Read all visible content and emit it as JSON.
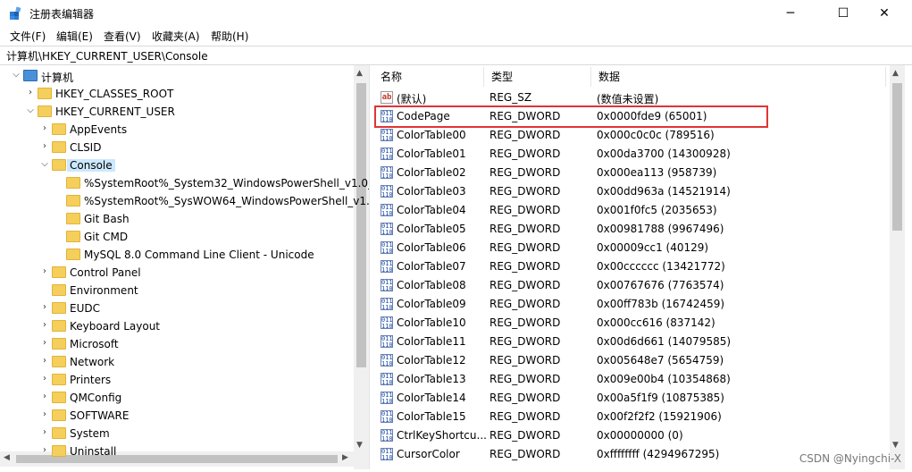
{
  "window": {
    "title": "注册表编辑器",
    "min_icon": "─",
    "max_icon": "☐",
    "close_icon": "✕"
  },
  "menu": [
    "文件(F)",
    "编辑(E)",
    "查看(V)",
    "收藏夹(A)",
    "帮助(H)"
  ],
  "address": "计算机\\HKEY_CURRENT_USER\\Console",
  "tree": [
    {
      "label": "计算机",
      "level": 0,
      "arrow": "⌵",
      "computer": true
    },
    {
      "label": "HKEY_CLASSES_ROOT",
      "level": 1,
      "arrow": "›"
    },
    {
      "label": "HKEY_CURRENT_USER",
      "level": 1,
      "arrow": "⌵"
    },
    {
      "label": "AppEvents",
      "level": 2,
      "arrow": "›"
    },
    {
      "label": "CLSID",
      "level": 2,
      "arrow": "›"
    },
    {
      "label": "Console",
      "level": 2,
      "arrow": "⌵",
      "selected": true
    },
    {
      "label": "%SystemRoot%_System32_WindowsPowerShell_v1.0_",
      "level": 3,
      "arrow": ""
    },
    {
      "label": "%SystemRoot%_SysWOW64_WindowsPowerShell_v1.",
      "level": 3,
      "arrow": ""
    },
    {
      "label": "Git Bash",
      "level": 3,
      "arrow": ""
    },
    {
      "label": "Git CMD",
      "level": 3,
      "arrow": ""
    },
    {
      "label": "MySQL 8.0 Command Line Client - Unicode",
      "level": 3,
      "arrow": ""
    },
    {
      "label": "Control Panel",
      "level": 2,
      "arrow": "›"
    },
    {
      "label": "Environment",
      "level": 2,
      "arrow": ""
    },
    {
      "label": "EUDC",
      "level": 2,
      "arrow": "›"
    },
    {
      "label": "Keyboard Layout",
      "level": 2,
      "arrow": "›"
    },
    {
      "label": "Microsoft",
      "level": 2,
      "arrow": "›"
    },
    {
      "label": "Network",
      "level": 2,
      "arrow": "›"
    },
    {
      "label": "Printers",
      "level": 2,
      "arrow": "›"
    },
    {
      "label": "QMConfig",
      "level": 2,
      "arrow": "›"
    },
    {
      "label": "SOFTWARE",
      "level": 2,
      "arrow": "›"
    },
    {
      "label": "System",
      "level": 2,
      "arrow": "›"
    },
    {
      "label": "Uninstall",
      "level": 2,
      "arrow": "›"
    }
  ],
  "columns": [
    "名称",
    "类型",
    "数据"
  ],
  "values": [
    {
      "name": "(默认)",
      "type": "REG_SZ",
      "data": "(数值未设置)",
      "icon": "sz"
    },
    {
      "name": "CodePage",
      "type": "REG_DWORD",
      "data": "0x0000fde9 (65001)",
      "icon": "dword"
    },
    {
      "name": "ColorTable00",
      "type": "REG_DWORD",
      "data": "0x000c0c0c (789516)",
      "icon": "dword"
    },
    {
      "name": "ColorTable01",
      "type": "REG_DWORD",
      "data": "0x00da3700 (14300928)",
      "icon": "dword"
    },
    {
      "name": "ColorTable02",
      "type": "REG_DWORD",
      "data": "0x000ea113 (958739)",
      "icon": "dword"
    },
    {
      "name": "ColorTable03",
      "type": "REG_DWORD",
      "data": "0x00dd963a (14521914)",
      "icon": "dword"
    },
    {
      "name": "ColorTable04",
      "type": "REG_DWORD",
      "data": "0x001f0fc5 (2035653)",
      "icon": "dword"
    },
    {
      "name": "ColorTable05",
      "type": "REG_DWORD",
      "data": "0x00981788 (9967496)",
      "icon": "dword"
    },
    {
      "name": "ColorTable06",
      "type": "REG_DWORD",
      "data": "0x00009cc1 (40129)",
      "icon": "dword"
    },
    {
      "name": "ColorTable07",
      "type": "REG_DWORD",
      "data": "0x00cccccc (13421772)",
      "icon": "dword"
    },
    {
      "name": "ColorTable08",
      "type": "REG_DWORD",
      "data": "0x00767676 (7763574)",
      "icon": "dword"
    },
    {
      "name": "ColorTable09",
      "type": "REG_DWORD",
      "data": "0x00ff783b (16742459)",
      "icon": "dword"
    },
    {
      "name": "ColorTable10",
      "type": "REG_DWORD",
      "data": "0x000cc616 (837142)",
      "icon": "dword"
    },
    {
      "name": "ColorTable11",
      "type": "REG_DWORD",
      "data": "0x00d6d661 (14079585)",
      "icon": "dword"
    },
    {
      "name": "ColorTable12",
      "type": "REG_DWORD",
      "data": "0x005648e7 (5654759)",
      "icon": "dword"
    },
    {
      "name": "ColorTable13",
      "type": "REG_DWORD",
      "data": "0x009e00b4 (10354868)",
      "icon": "dword"
    },
    {
      "name": "ColorTable14",
      "type": "REG_DWORD",
      "data": "0x00a5f1f9 (10875385)",
      "icon": "dword"
    },
    {
      "name": "ColorTable15",
      "type": "REG_DWORD",
      "data": "0x00f2f2f2 (15921906)",
      "icon": "dword"
    },
    {
      "name": "CtrlKeyShortcu...",
      "type": "REG_DWORD",
      "data": "0x00000000 (0)",
      "icon": "dword"
    },
    {
      "name": "CursorColor",
      "type": "REG_DWORD",
      "data": "0xffffffff (4294967295)",
      "icon": "dword"
    }
  ],
  "watermark": "CSDN @Nyingchi-X",
  "colors": {
    "selection": "#cce8ff",
    "highlight_border": "#e03434",
    "folder": "#f5cf5c"
  }
}
